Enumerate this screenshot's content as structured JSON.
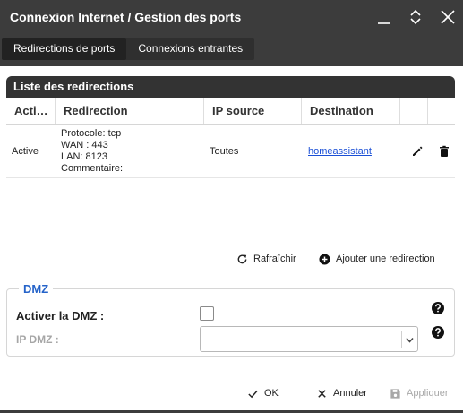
{
  "window": {
    "title": "Connexion Internet / Gestion des ports",
    "tabs": [
      {
        "label": "Redirections de ports",
        "active": true
      },
      {
        "label": "Connexions entrantes",
        "active": false
      }
    ]
  },
  "redirections": {
    "panel_title": "Liste des redirections",
    "columns": [
      "Acti…",
      "Redirection",
      "IP source",
      "Destination",
      "",
      ""
    ],
    "rows": [
      {
        "status": "Active",
        "protocol": "Protocole: tcp",
        "wan": "WAN : 443",
        "lan": "LAN: 8123",
        "comment": "Commentaire:",
        "ip_source": "Toutes",
        "destination": "homeassistant"
      }
    ],
    "refresh_label": "Rafraîchir",
    "add_label": "Ajouter une redirection"
  },
  "dmz": {
    "legend": "DMZ",
    "enable_label": "Activer la DMZ :",
    "enable_checked": false,
    "ip_label": "IP DMZ :",
    "ip_value": ""
  },
  "footer": {
    "ok_label": "OK",
    "cancel_label": "Annuler",
    "apply_label": "Appliquer"
  },
  "colors": {
    "titlebar": "#3c3c3c",
    "accent": "#2563c9",
    "link": "#1a4fd6",
    "disabled": "#a8a8a8"
  }
}
